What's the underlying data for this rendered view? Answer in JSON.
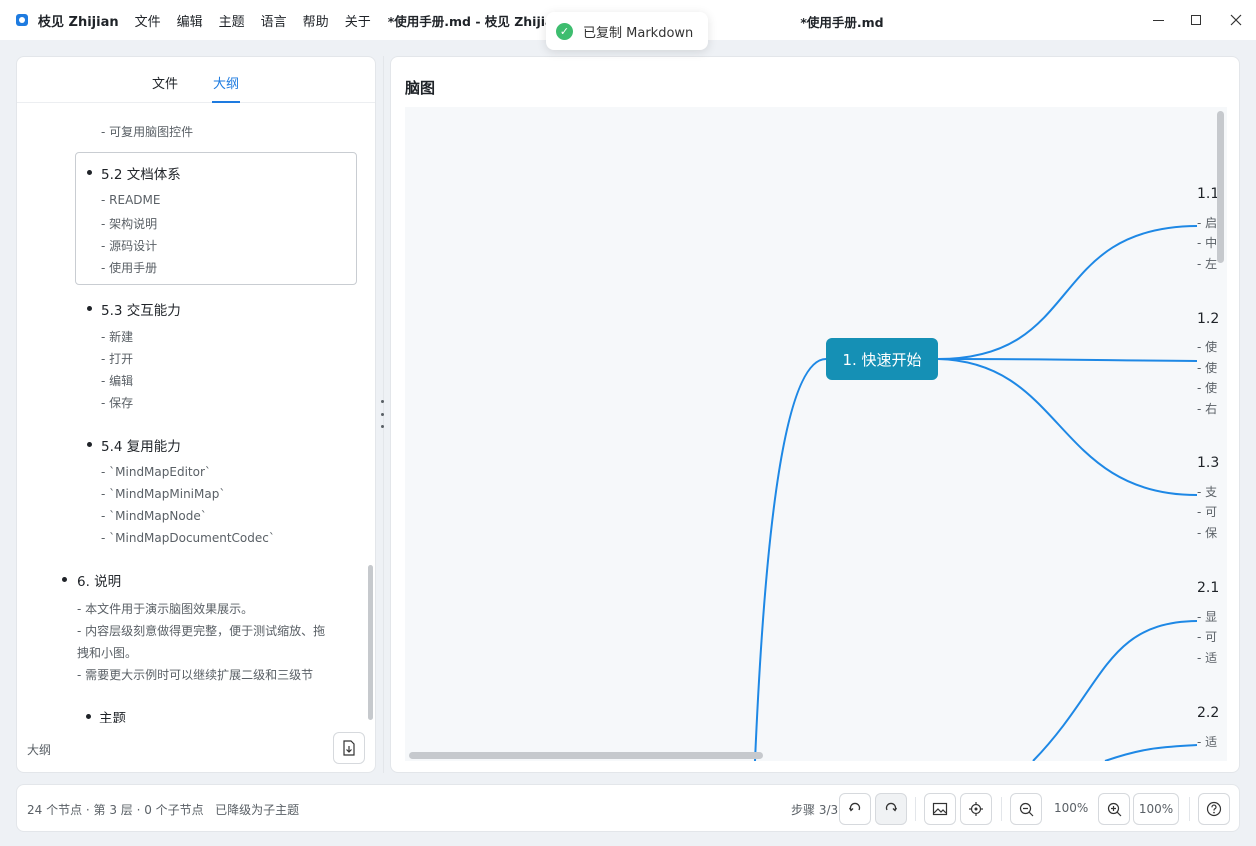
{
  "titlebar": {
    "app_name": "枝见 Zhijian",
    "menus": [
      "文件",
      "编辑",
      "主题",
      "语言",
      "帮助",
      "关于"
    ],
    "doc_title_left": "*使用手册.md - 枝见 Zhijian",
    "doc_title_center": "*使用手册.md"
  },
  "toast": {
    "text": "已复制 Markdown"
  },
  "left_panel": {
    "tabs": [
      "文件",
      "大纲"
    ],
    "active_tab": "大纲",
    "outline": {
      "top_sub": "- 可复用脑图控件",
      "sections": [
        {
          "title": "5.2 文档体系",
          "items": [
            "- README",
            "- 架构说明",
            "- 源码设计",
            "- 使用手册"
          ]
        },
        {
          "title": "5.3 交互能力",
          "items": [
            "- 新建",
            "- 打开",
            "- 编辑",
            "- 保存"
          ]
        },
        {
          "title": "5.4 复用能力",
          "items": [
            "- `MindMapEditor`",
            "- `MindMapMiniMap`",
            "- `MindMapNode`",
            "- `MindMapDocumentCodec`"
          ]
        }
      ],
      "section6": {
        "title": "6. 说明",
        "lines": [
          "- 本文件用于演示脑图效果展示。",
          "- 内容层级刻意做得更完整，便于测试缩放、拖",
          "拽和小图。",
          "- 需要更大示例时可以继续扩展二级和三级节"
        ]
      },
      "theme_item": "主题"
    },
    "footer_label": "大纲"
  },
  "right_panel": {
    "title": "脑图",
    "root_node": "1. 快速开始",
    "branches": [
      {
        "label": "1.1",
        "subs": [
          "- 启",
          "- 中",
          "- 左"
        ]
      },
      {
        "label": "1.2",
        "subs": [
          "- 使",
          "- 使",
          "- 使",
          "- 右"
        ]
      },
      {
        "label": "1.3",
        "subs": [
          "- 支",
          "- 可",
          "- 保"
        ]
      },
      {
        "label": "2.1",
        "subs": [
          "- 显",
          "- 可",
          "- 适"
        ]
      },
      {
        "label": "2.2",
        "subs": [
          "- 适"
        ]
      }
    ]
  },
  "statusbar": {
    "info": "24 个节点 · 第 3 层 · 0 个子节点",
    "hint": "已降级为子主题",
    "step": "步骤 3/3",
    "zoom_value": "100%",
    "zoom_box": "100%"
  },
  "colors": {
    "accent": "#1e7be0",
    "root_node": "#1590b5",
    "edge": "#1e88e5",
    "toast_success": "#3ebd6f"
  }
}
